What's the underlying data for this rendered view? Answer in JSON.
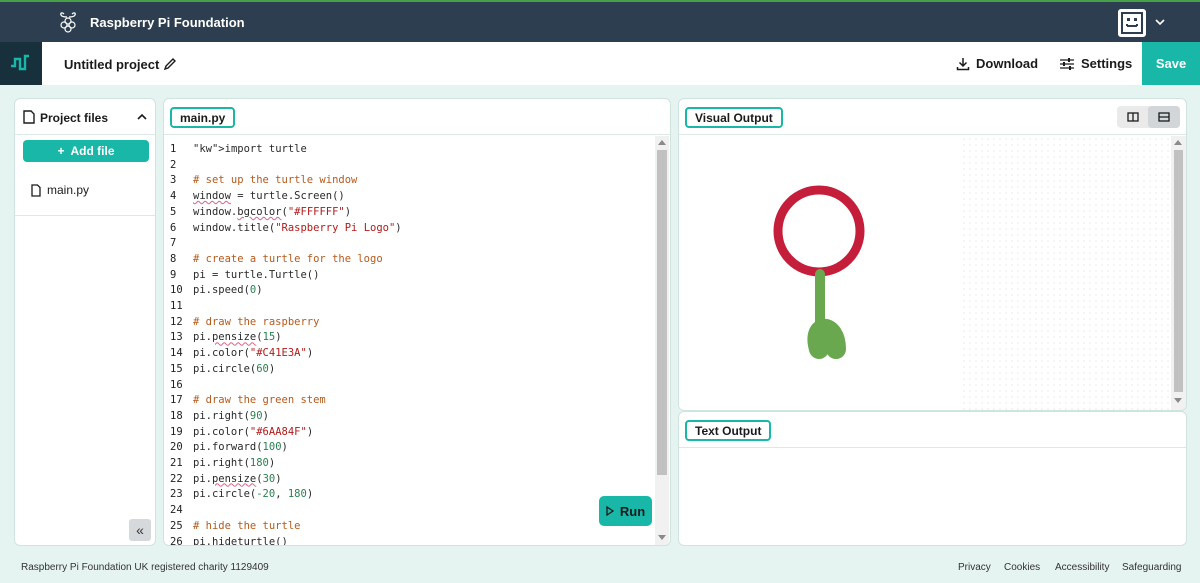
{
  "topbar": {
    "brand": "Raspberry Pi Foundation"
  },
  "project": {
    "title": "Untitled project"
  },
  "toolbar": {
    "download_label": "Download",
    "settings_label": "Settings",
    "save_label": "Save"
  },
  "files": {
    "heading": "Project files",
    "add_label": "Add file",
    "items": [
      "main.py"
    ],
    "collapse_label": "«"
  },
  "editor": {
    "tab": "main.py",
    "run_label": "Run",
    "lines": [
      "import turtle",
      "",
      "# set up the turtle window",
      "window = turtle.Screen()",
      "window.bgcolor(\"#FFFFFF\")",
      "window.title(\"Raspberry Pi Logo\")",
      "",
      "# create a turtle for the logo",
      "pi = turtle.Turtle()",
      "pi.speed(0)",
      "",
      "# draw the raspberry",
      "pi.pensize(15)",
      "pi.color(\"#C41E3A\")",
      "pi.circle(60)",
      "",
      "# draw the green stem",
      "pi.right(90)",
      "pi.color(\"#6AA84F\")",
      "pi.forward(100)",
      "pi.right(180)",
      "pi.pensize(30)",
      "pi.circle(-20, 180)",
      "",
      "# hide the turtle",
      "pi.hideturtle()"
    ]
  },
  "visual": {
    "tab": "Visual Output",
    "raspberry_color": "#C41E3A",
    "stem_color": "#6AA84F"
  },
  "text_output": {
    "tab": "Text Output"
  },
  "footer": {
    "charity": "Raspberry Pi Foundation UK registered charity 1129409",
    "links": [
      "Privacy",
      "Cookies",
      "Accessibility",
      "Safeguarding"
    ]
  },
  "colors": {
    "accent": "#18B7A8",
    "topbar": "#2D3E50",
    "background": "#E6F4F1"
  }
}
